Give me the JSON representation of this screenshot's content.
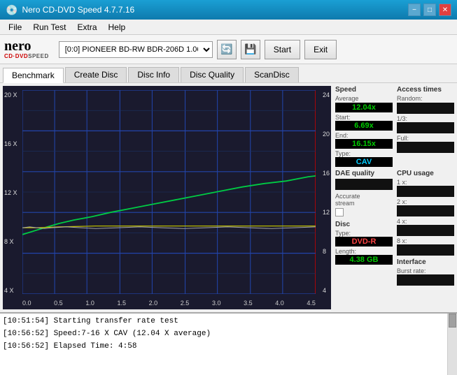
{
  "titleBar": {
    "title": "Nero CD-DVD Speed 4.7.7.16",
    "minimize": "−",
    "maximize": "□",
    "close": "✕"
  },
  "menu": {
    "items": [
      "File",
      "Run Test",
      "Extra",
      "Help"
    ]
  },
  "toolbar": {
    "driveLabel": "[0:0]  PIONEER BD-RW  BDR-206D 1.06",
    "startBtn": "Start",
    "exitBtn": "Exit"
  },
  "tabs": [
    "Benchmark",
    "Create Disc",
    "Disc Info",
    "Disc Quality",
    "ScanDisc"
  ],
  "activeTab": "Benchmark",
  "chart": {
    "yLeftLabels": [
      "20 X",
      "16 X",
      "12 X",
      "8 X",
      "4 X"
    ],
    "yRightLabels": [
      "24",
      "20",
      "16",
      "12",
      "8",
      "4"
    ],
    "xLabels": [
      "0.0",
      "0.5",
      "1.0",
      "1.5",
      "2.0",
      "2.5",
      "3.0",
      "3.5",
      "4.0",
      "4.5"
    ]
  },
  "stats": {
    "speed": {
      "title": "Speed",
      "averageLabel": "Average",
      "averageValue": "12.04x",
      "startLabel": "Start:",
      "startValue": "6.69x",
      "endLabel": "End:",
      "endValue": "16.15x",
      "typeLabel": "Type:",
      "typeValue": "CAV"
    },
    "dae": {
      "title": "DAE quality",
      "accurateLabel": "Accurate",
      "streamLabel": "stream"
    },
    "disc": {
      "title": "Disc",
      "typeLabel": "Type:",
      "typeValue": "DVD-R",
      "lengthLabel": "Length:",
      "lengthValue": "4.38 GB"
    },
    "accessTimes": {
      "title": "Access times",
      "randomLabel": "Random:",
      "randomValue": "",
      "oneThirdLabel": "1/3:",
      "oneThirdValue": "",
      "fullLabel": "Full:",
      "fullValue": ""
    },
    "cpuUsage": {
      "title": "CPU usage",
      "1x": "1 x:",
      "1xValue": "",
      "2x": "2 x:",
      "2xValue": "",
      "4x": "4 x:",
      "4xValue": "",
      "8x": "8 x:",
      "8xValue": ""
    },
    "interface": {
      "title": "Interface",
      "burstRateLabel": "Burst rate:",
      "burstRateValue": ""
    }
  },
  "log": {
    "entries": [
      "[10:51:54]  Starting transfer rate test",
      "[10:56:52]  Speed:7-16 X CAV (12.04 X average)",
      "[10:56:52]  Elapsed Time: 4:58"
    ]
  }
}
